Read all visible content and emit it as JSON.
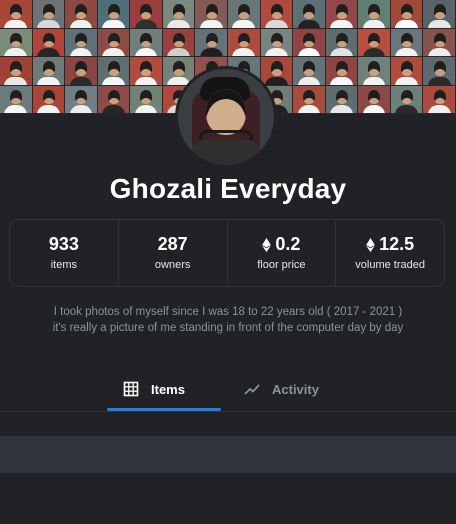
{
  "profile": {
    "title": "Ghozali Everyday"
  },
  "stats": [
    {
      "value": "933",
      "label": "items",
      "icon": ""
    },
    {
      "value": "287",
      "label": "owners",
      "icon": ""
    },
    {
      "value": "0.2",
      "label": "floor price",
      "icon": "ethereum-icon"
    },
    {
      "value": "12.5",
      "label": "volume traded",
      "icon": "ethereum-icon"
    }
  ],
  "description": {
    "line1": "I took photos of myself since I was 18 to 22 years old ( 2017 - 2021 )",
    "line2": "it's really a picture of me standing in front of the computer day by day"
  },
  "tabs": [
    {
      "label": "Items",
      "icon": "grid-icon",
      "active": true
    },
    {
      "label": "Activity",
      "icon": "activity-icon",
      "active": false
    }
  ],
  "colors": {
    "background": "#202225",
    "border": "#303339",
    "text": "#e5e8eb",
    "muted": "#8a939b",
    "accent": "#2081e2",
    "filter_bar": "#303339"
  }
}
